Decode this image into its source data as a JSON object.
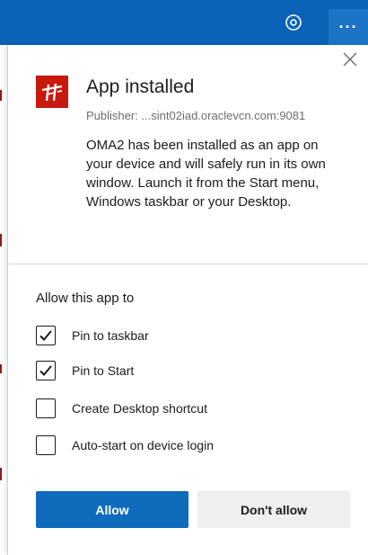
{
  "dialog": {
    "title": "App installed",
    "publisher": "Publisher: ...sint02iad.oraclevcn.com:9081",
    "description": "OMA2 has been installed as an app on your device and will safely run in its own window. Launch it from the Start menu, Windows taskbar or your Desktop.",
    "app_icon": "oracle-app-icon",
    "close_icon": "close-icon"
  },
  "permissions": {
    "heading": "Allow this app to",
    "options": [
      {
        "label": "Pin to taskbar",
        "checked": true
      },
      {
        "label": "Pin to Start",
        "checked": true
      },
      {
        "label": "Create Desktop shortcut",
        "checked": false
      },
      {
        "label": "Auto-start on device login",
        "checked": false
      }
    ]
  },
  "buttons": {
    "allow_label": "Allow",
    "dont_allow_label": "Don't allow"
  },
  "toolbar": {
    "location_icon": "location-icon",
    "more_label": "···"
  },
  "colors": {
    "accent": "#0f6cbd",
    "toolbar_bg": "#0a63b7",
    "app_icon_bg": "#c8190e",
    "secondary_button_bg": "#efefef"
  }
}
